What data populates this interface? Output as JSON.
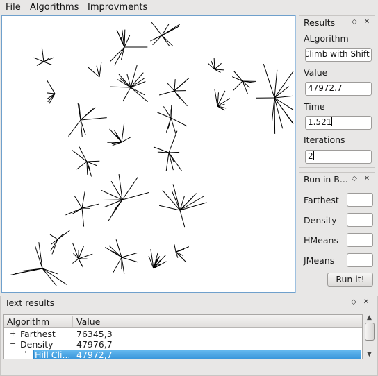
{
  "menubar": {
    "items": [
      "File",
      "Algorithms",
      "Improvments"
    ]
  },
  "results_panel": {
    "title": "Results",
    "algorithm_label": "ALgorithm",
    "algorithm_value": "Climb with Shift",
    "value_label": "Value",
    "value_value": "47972.7",
    "time_label": "Time",
    "time_value": "1.521",
    "iterations_label": "Iterations",
    "iterations_value": "2"
  },
  "run_panel": {
    "title": "Run in B...",
    "farthest_label": "Farthest",
    "density_label": "Density",
    "hmeans_label": "HMeans",
    "jmeans_label": "JMeans",
    "run_button": "Run it!"
  },
  "text_results": {
    "title": "Text results",
    "headers": {
      "algorithm": "Algorithm",
      "value": "Value"
    },
    "rows": [
      {
        "expander": "+",
        "algorithm": "Farthest",
        "value": "76345,3"
      },
      {
        "expander": "−",
        "algorithm": "Density",
        "value": "47976,7"
      },
      {
        "expander": "",
        "algorithm": "Hill Cli...",
        "value": "47972,7"
      }
    ]
  },
  "dock_buttons": {
    "float": "◇",
    "close": "✕"
  },
  "scrollbar": {
    "up": "▲",
    "down": "▼"
  }
}
